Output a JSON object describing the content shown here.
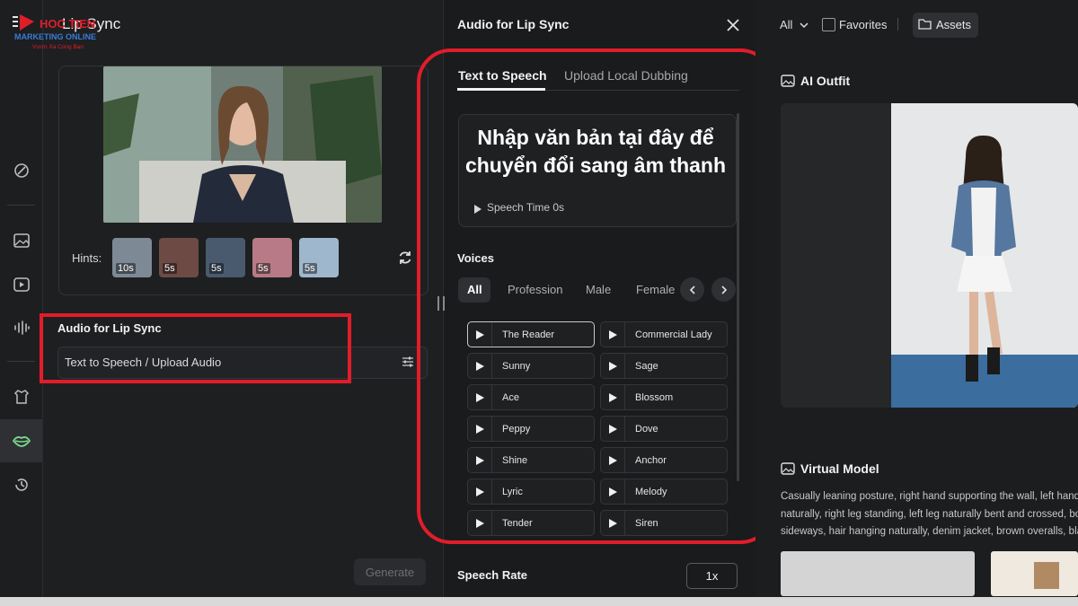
{
  "app": {
    "title": "Lip Sync",
    "logo_text": "HOC TIEN",
    "logo_sub": "MARKETING ONLINE",
    "logo_tagline": "Vươn Xa Cùng Bạn"
  },
  "rail": {
    "icons": [
      "edit-shape-icon",
      "image-icon",
      "video-icon",
      "audio-wave-icon",
      "outfit-icon",
      "lips-icon",
      "history-icon"
    ]
  },
  "left": {
    "hints_label": "Hints:",
    "hints": [
      {
        "duration": "10s",
        "color": "#7d8a96"
      },
      {
        "duration": "5s",
        "color": "#6e4a45"
      },
      {
        "duration": "5s",
        "color": "#4a5a6e"
      },
      {
        "duration": "5s",
        "color": "#b87a86"
      },
      {
        "duration": "5s",
        "color": "#9fb7cc"
      }
    ],
    "audio_title": "Audio for Lip Sync",
    "audio_value": "Text to Speech / Upload Audio",
    "generate_label": "Generate"
  },
  "middle": {
    "title": "Audio for Lip Sync",
    "tabs": [
      "Text to Speech",
      "Upload Local Dubbing"
    ],
    "overlay_text": "Nhập văn bản tại đây để chuyển đổi sang âm thanh",
    "speech_time": "Speech Time 0s",
    "voices_title": "Voices",
    "filters": [
      "All",
      "Profession",
      "Male",
      "Female"
    ],
    "voices_left": [
      "The Reader",
      "Sunny",
      "Ace",
      "Peppy",
      "Shine",
      "Lyric",
      "Tender"
    ],
    "voices_right": [
      "Commercial Lady",
      "Sage",
      "Blossom",
      "Dove",
      "Anchor",
      "Melody",
      "Siren"
    ],
    "speech_rate_label": "Speech Rate",
    "speech_rate_value": "1x"
  },
  "right": {
    "filter_all": "All",
    "favorites_label": "Favorites",
    "assets_label": "Assets",
    "outfit_title": "AI Outfit",
    "virtual_model_title": "Virtual Model",
    "description": [
      "Casually leaning posture, right hand supporting the wall, left hand",
      "naturally, right leg standing, left leg naturally bent and crossed, bod",
      "sideways, hair hanging naturally, denim jacket, brown overalls, bla"
    ]
  },
  "colors": {
    "highlight_red": "#e11d2a",
    "accent_green": "#7bd88f"
  }
}
